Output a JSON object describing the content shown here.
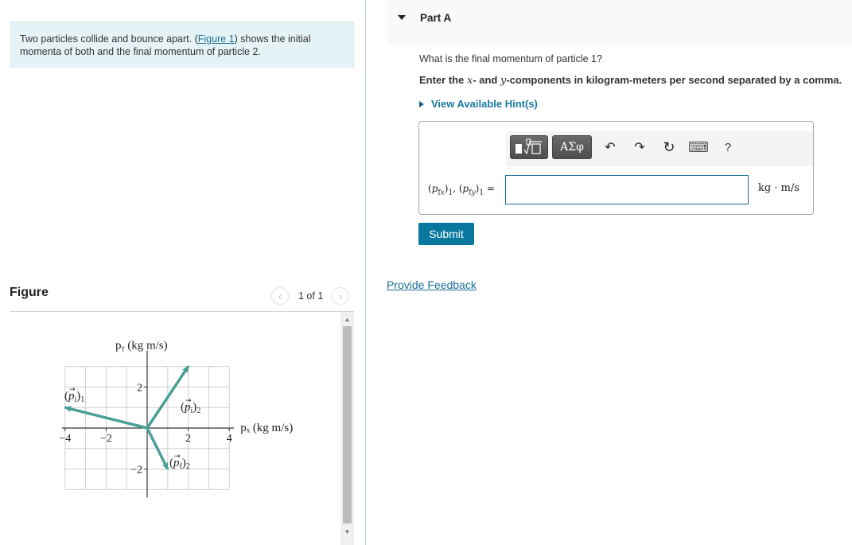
{
  "intro": {
    "text_before": "Two particles collide and bounce apart. (",
    "link": "Figure 1",
    "text_after": ") shows the initial momenta of both and the final momentum of particle 2."
  },
  "figure_panel": {
    "title": "Figure",
    "pager": {
      "prev_icon": "‹",
      "text": "1 of 1",
      "next_icon": "›"
    }
  },
  "part": {
    "label": "Part A",
    "question": "What is the final momentum of particle 1?",
    "instruction_pre": "Enter the ",
    "instruction_x": "x",
    "instruction_mid": "- and ",
    "instruction_y": "y",
    "instruction_post": "-components in kilogram-meters per second separated by a comma.",
    "hint_label": "View Available Hint(s)",
    "toolbar": {
      "templates_label": "▮√□",
      "greek_label": "ΑΣφ",
      "undo": "↶",
      "redo": "↷",
      "reset": "↻",
      "keyboard": "⌨",
      "help": "?"
    },
    "equation_label": "(p_fx)1, (p_fy)1 =",
    "answer_value": "",
    "units": "kg · m/s",
    "submit_label": "Submit"
  },
  "feedback_label": "Provide Feedback",
  "chart_data": {
    "type": "vector",
    "xlabel": "p_x (kg m/s)",
    "ylabel": "p_y (kg m/s)",
    "xlim": [
      -4,
      4
    ],
    "ylim": [
      -3,
      3
    ],
    "grid": true,
    "x_ticks": [
      -4,
      -2,
      2,
      4
    ],
    "y_ticks": [
      2,
      -2
    ],
    "vectors": [
      {
        "name": "(p_i)_1",
        "label_main": "p",
        "label_sub": "i",
        "label_index": "1",
        "x": -4,
        "y": 1
      },
      {
        "name": "(p_i)_2",
        "label_main": "p",
        "label_sub": "i",
        "label_index": "2",
        "x": 2,
        "y": 3
      },
      {
        "name": "(p_f)_2",
        "label_main": "p",
        "label_sub": "f",
        "label_index": "2",
        "x": 1,
        "y": -2
      }
    ],
    "color": "#4a9f97"
  }
}
